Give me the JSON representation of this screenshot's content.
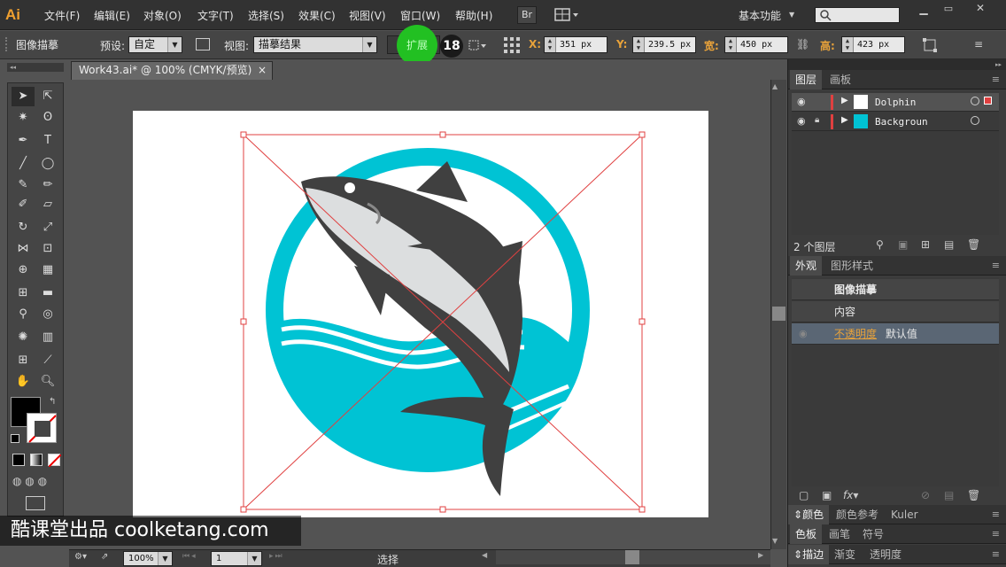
{
  "app": {
    "logo": "Ai",
    "menus": [
      "文件(F)",
      "编辑(E)",
      "对象(O)",
      "文字(T)",
      "选择(S)",
      "效果(C)",
      "视图(V)",
      "窗口(W)",
      "帮助(H)"
    ],
    "bridge": "Br",
    "workspace": "基本功能"
  },
  "control": {
    "mode_label": "图像描摹",
    "preset_label": "预设:",
    "preset_value": "自定",
    "view_label": "视图:",
    "view_value": "描摹结果",
    "expand_label": "扩展",
    "step_badge": "18",
    "x_label": "X:",
    "x_value": "351 px",
    "y_label": "Y:",
    "y_value": "239.5 px",
    "w_label": "宽:",
    "w_value": "450 px",
    "h_label": "高:",
    "h_value": "423 px"
  },
  "document": {
    "tab_title": "Work43.ai* @ 100% (CMYK/预览)",
    "close_symbol": "×"
  },
  "layers_panel": {
    "tabs": [
      "图层",
      "画板"
    ],
    "layers": [
      {
        "name": "Dolphin"
      },
      {
        "name": "Backgroun"
      }
    ],
    "count_text": "2 个图层"
  },
  "appearance_panel": {
    "tabs": [
      "外观",
      "图形样式"
    ],
    "title": "图像描摹",
    "content_label": "内容",
    "opacity_label": "不透明度",
    "opacity_value": "默认值"
  },
  "bottom_panels": {
    "row1": [
      "颜色",
      "颜色参考",
      "Kuler"
    ],
    "row2": [
      "色板",
      "画笔",
      "符号"
    ],
    "row3": [
      "描边",
      "渐变",
      "透明度"
    ]
  },
  "status": {
    "zoom": "100%",
    "page": "1",
    "tool": "选择"
  },
  "watermark": {
    "text": "酷课堂出品 coolketang.com"
  },
  "colors": {
    "accent": "#00c3d4",
    "dolphin": "#404040",
    "belly": "#dcdedf",
    "bbox": "#e04040",
    "highlight_orange": "#e8a23a"
  }
}
